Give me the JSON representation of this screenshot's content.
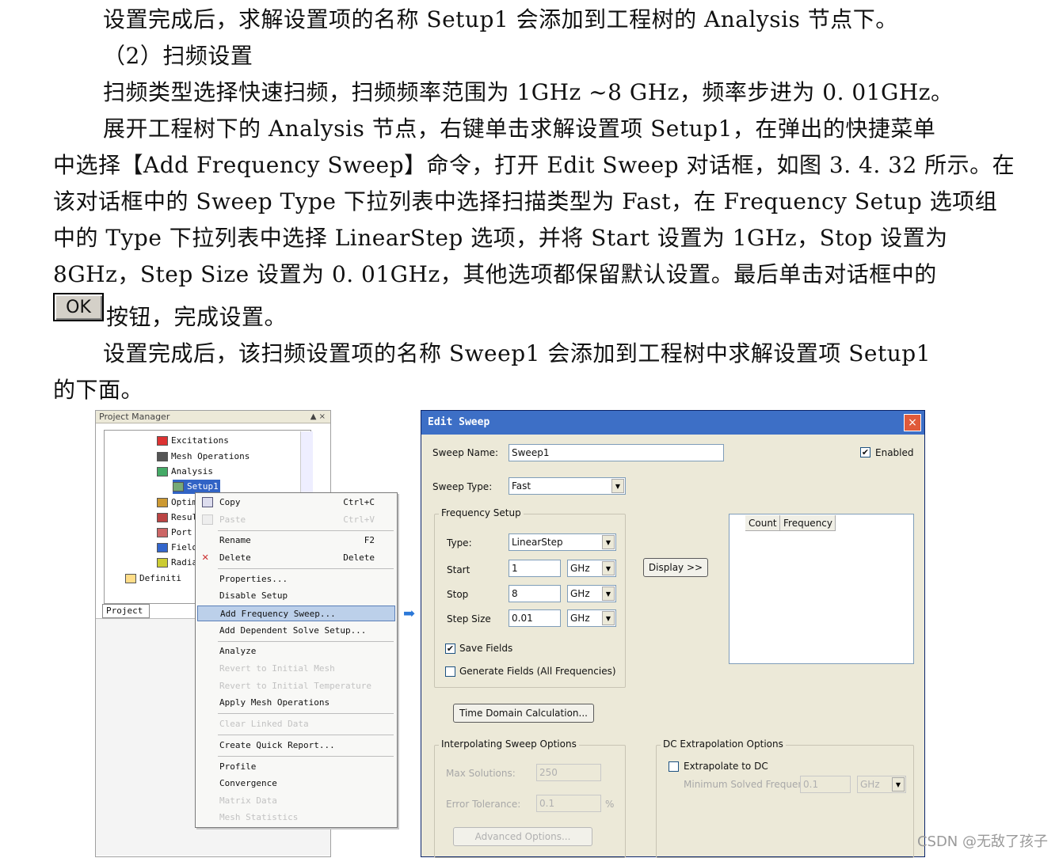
{
  "text": {
    "line1": "设置完成后，求解设置项的名称 Setup1 会添加到工程树的 Analysis 节点下。",
    "line2": "（2）扫频设置",
    "line3": "扫频类型选择快速扫频，扫频频率范围为 1GHz ~8 GHz，频率步进为 0. 01GHz。",
    "line4": "展开工程树下的 Analysis 节点，右键单击求解设置项 Setup1，在弹出的快捷菜单",
    "line5": "中选择【Add Frequency Sweep】命令，打开 Edit Sweep 对话框，如图 3. 4. 32 所示。在",
    "line6": "该对话框中的 Sweep Type 下拉列表中选择扫描类型为 Fast，在 Frequency Setup 选项组",
    "line7": "中的 Type 下拉列表中选择 LinearStep 选项，并将 Start 设置为 1GHz，Stop 设置为",
    "line8": "8GHz，Step Size 设置为 0. 01GHz，其他选项都保留默认设置。最后单击对话框中的",
    "ok_label": "OK",
    "line9_after_ok": "按钮，完成设置。",
    "line10": "设置完成后，该扫频设置项的名称 Sweep1 会添加到工程树中求解设置项 Setup1",
    "line11": "的下面。"
  },
  "project_manager": {
    "title": "Project Manager",
    "controls": "▲ ×",
    "tree": [
      "Excitations",
      "Mesh Operations",
      "Analysis",
      "Setup1",
      "Optim",
      "Resul",
      "Port",
      "Field",
      "Radia",
      "Definiti"
    ],
    "tab": "Project"
  },
  "context_menu": {
    "items": [
      {
        "label": "Copy",
        "shortcut": "Ctrl+C"
      },
      {
        "label": "Paste",
        "shortcut": "Ctrl+V"
      },
      {
        "label": "Rename",
        "shortcut": "F2"
      },
      {
        "label": "Delete",
        "shortcut": "Delete"
      },
      {
        "label": "Properties..."
      },
      {
        "label": "Disable Setup"
      },
      {
        "label": "Add Frequency Sweep..."
      },
      {
        "label": "Add Dependent Solve Setup..."
      },
      {
        "label": "Analyze"
      },
      {
        "label": "Revert to Initial Mesh"
      },
      {
        "label": "Revert to Initial Temperature"
      },
      {
        "label": "Apply Mesh Operations"
      },
      {
        "label": "Clear Linked Data"
      },
      {
        "label": "Create Quick Report..."
      },
      {
        "label": "Profile"
      },
      {
        "label": "Convergence"
      },
      {
        "label": "Matrix Data"
      },
      {
        "label": "Mesh Statistics"
      }
    ]
  },
  "dialog": {
    "title": "Edit Sweep",
    "close": "×",
    "sweep_name_label": "Sweep Name:",
    "sweep_name": "Sweep1",
    "enabled_label": "Enabled",
    "sweep_type_label": "Sweep Type:",
    "sweep_type": "Fast",
    "freq_setup_label": "Frequency Setup",
    "type_label": "Type:",
    "type_value": "LinearStep",
    "start_label": "Start",
    "start_value": "1",
    "stop_label": "Stop",
    "stop_value": "8",
    "step_label": "Step Size",
    "step_value": "0.01",
    "unit": "GHz",
    "display_btn": "Display >>",
    "col_count": "Count",
    "col_freq": "Frequency",
    "save_fields": "Save Fields",
    "generate_fields": "Generate Fields (All Frequencies)",
    "time_domain_btn": "Time Domain Calculation...",
    "interp_label": "Interpolating Sweep Options",
    "max_solutions_label": "Max Solutions:",
    "max_solutions": "250",
    "error_tol_label": "Error Tolerance:",
    "error_tol": "0.1",
    "percent": "%",
    "advanced_btn": "Advanced Options...",
    "dc_label": "DC Extrapolation Options",
    "extrapolate_label": "Extrapolate to DC",
    "min_freq_label": "Minimum Solved Frequency",
    "min_freq": "0.1",
    "min_unit": "GHz"
  },
  "check_mark": "✔",
  "dropdown_arrow": "▼",
  "watermark": "CSDN @无敌了孩子"
}
